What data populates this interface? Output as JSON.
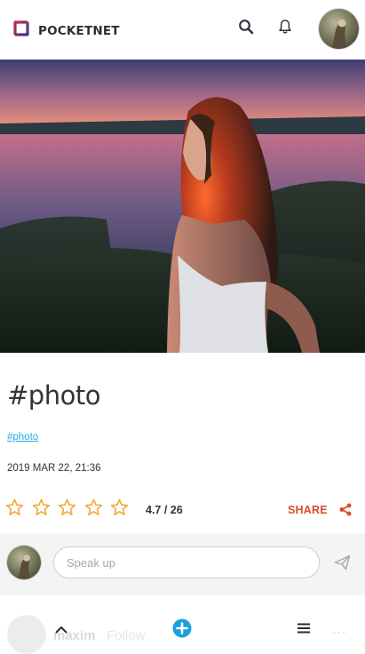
{
  "header": {
    "app_name": "POCKETNET",
    "icons": {
      "search": "search-icon",
      "notifications": "bell-icon"
    },
    "brand_color": "#b8274c"
  },
  "post": {
    "title": "#photo",
    "tag": "#photo",
    "date": "2019 MAR 22, 21:36",
    "rating": "4.7 / 26",
    "stars_filled": 0,
    "stars_total": 5,
    "share_label": "SHARE",
    "share_color": "#dd4b2a",
    "star_color": "#f0a830"
  },
  "comment": {
    "placeholder": "Speak up",
    "value": ""
  },
  "faded_row": {
    "name": "maxim",
    "follow": "Follow"
  },
  "bottom_nav": {
    "up": "chevron-up-icon",
    "add": "plus-circle-icon",
    "menu": "menu-icon",
    "accent": "#1e9fe0"
  }
}
